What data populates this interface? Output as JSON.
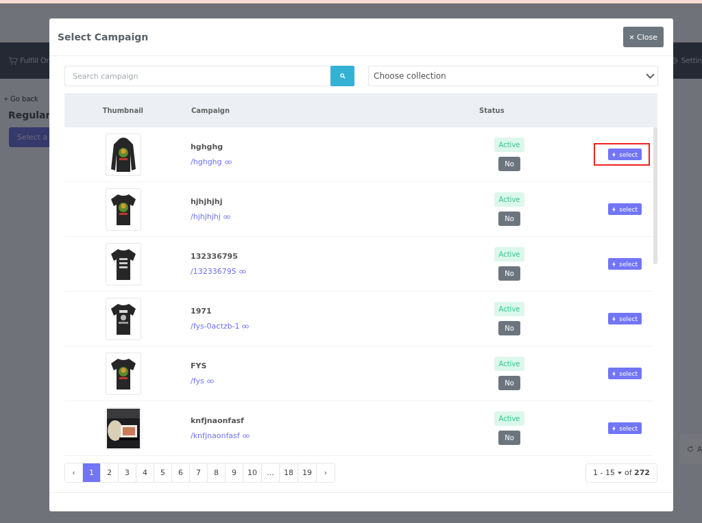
{
  "background": {
    "nav_left": "Fulfill Or",
    "nav_right": "Settin",
    "go_back": "Go back",
    "heading": "Regular",
    "button": "Select a",
    "side_card": "A"
  },
  "modal": {
    "title": "Select Campaign",
    "close": "Close",
    "search": {
      "placeholder": "Search campaign"
    },
    "collection": {
      "placeholder": "Choose collection"
    },
    "table": {
      "columns": [
        "Thumbnail",
        "Campaign",
        "Status"
      ],
      "rows": [
        {
          "name": "hghghg",
          "slug": "/hghghg",
          "status": "Active",
          "flag": "No",
          "action": "select",
          "highlighted": true
        },
        {
          "name": "hjhjhjhj",
          "slug": "/hjhjhjhj",
          "status": "Active",
          "flag": "No",
          "action": "select",
          "highlighted": false
        },
        {
          "name": "132336795",
          "slug": "/132336795",
          "status": "Active",
          "flag": "No",
          "action": "select",
          "highlighted": false
        },
        {
          "name": "1971",
          "slug": "/fys-0actzb-1",
          "status": "Active",
          "flag": "No",
          "action": "select",
          "highlighted": false
        },
        {
          "name": "FYS",
          "slug": "/fys",
          "status": "Active",
          "flag": "No",
          "action": "select",
          "highlighted": false
        },
        {
          "name": "knfjnaonfasf",
          "slug": "/knfjnaonfasf",
          "status": "Active",
          "flag": "No",
          "action": "select",
          "highlighted": false
        }
      ]
    },
    "pagination": {
      "prev": "‹",
      "next": "›",
      "pages": [
        {
          "label": "1",
          "selected": true
        },
        {
          "label": "2",
          "selected": false
        },
        {
          "label": "3",
          "selected": false
        },
        {
          "label": "4",
          "selected": false
        },
        {
          "label": "5",
          "selected": false
        },
        {
          "label": "6",
          "selected": false
        },
        {
          "label": "7",
          "selected": false
        },
        {
          "label": "8",
          "selected": false
        },
        {
          "label": "9",
          "selected": false
        },
        {
          "label": "10",
          "selected": false
        },
        {
          "label": "...",
          "selected": false
        },
        {
          "label": "18",
          "selected": false
        },
        {
          "label": "19",
          "selected": false
        }
      ]
    },
    "range": {
      "shown": "1 - 15",
      "total": "of **272**"
    }
  }
}
